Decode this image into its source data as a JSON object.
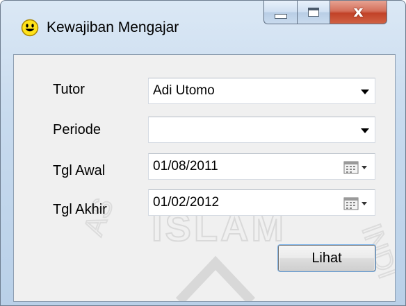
{
  "window": {
    "title": "Kewajiban Mengajar",
    "icon": "smiley-icon",
    "controls": {
      "minimize": "minimize-icon",
      "maximize": "maximize-icon",
      "close_glyph": "x"
    }
  },
  "form": {
    "tutor": {
      "label": "Tutor",
      "value": "Adi Utomo"
    },
    "periode": {
      "label": "Periode",
      "value": ""
    },
    "tgl_awal": {
      "label": "Tgl Awal",
      "value": "01/08/2011"
    },
    "tgl_akhir": {
      "label": "Tgl Akhir",
      "value": "01/02/2012"
    },
    "lihat_label": "Lihat"
  },
  "watermark": {
    "text": "ISLAM",
    "color": "#d9d9d9"
  },
  "colors": {
    "title_bar": "#c7daee",
    "client_bg": "#f0f0f0",
    "close_button": "#c24228"
  }
}
